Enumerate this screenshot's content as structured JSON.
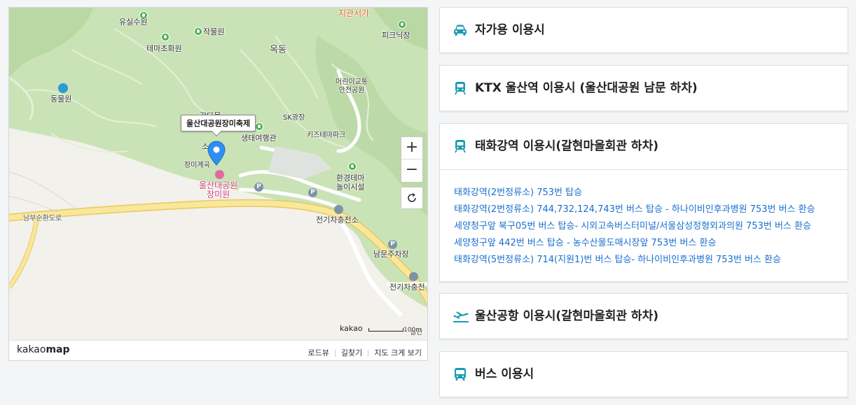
{
  "map": {
    "labels": {
      "yusil": "유실수원",
      "jakmul": "작물원",
      "tema": "테마초화원",
      "okdong": "옥동",
      "jigwan": "지관서가",
      "picnic": "피크닉장",
      "zoo": "동물원",
      "kids_safety": "어린이교통\n안전공원",
      "sk": "SK광장",
      "eco": "생태여행관",
      "kidspark": "키즈테마파크",
      "eco_play": "환경테마\n놀이시설",
      "rose_valley": "장미계곡",
      "rose_garden": "울산대공원\n장미원",
      "charge1": "전기차충전소",
      "charge2": "전기차충전",
      "south_parking": "남문주차장",
      "road": "남부순환도로",
      "partial1": "감다목",
      "partial2": "소",
      "partial3": "일반"
    },
    "callout": "울산대공원장미축제",
    "zoom_in": "+",
    "zoom_out": "−",
    "scale_brand": "kakao",
    "scale_text": "100m",
    "brand_light": "kakao",
    "brand_bold": "map",
    "footer_links": [
      "로드뷰",
      "길찾기",
      "지도 크게 보기"
    ]
  },
  "accordion": [
    {
      "icon": "car-icon",
      "title": "자가용 이용시"
    },
    {
      "icon": "train-icon",
      "title": "KTX 울산역 이용시 (울산대공원 남문 하차)"
    },
    {
      "icon": "train-icon",
      "title": "태화강역 이용시(갈현마을회관 하차)",
      "routes": [
        "태화강역(2번정류소) 753번 탑승",
        "태화강역(2번정류소) 744,732,124,743번 버스 탑승 - 하나이비인후과병원 753번 버스 환승",
        "세양청구앞 북구05번 버스 탑승- 시외고속버스터미널/서울삼성정형외과의원 753번 버스 환승",
        "세양청구앞 442번 버스 탑승 - 농수산물도매시장앞 753번 버스 환승",
        "태화강역(5번정류소) 714(지원1)번 버스 탑승- 하나이비인후과병원 753번 버스 환승"
      ]
    },
    {
      "icon": "plane-icon",
      "title": "울산공항 이용시(갈현마을회관 하차)"
    },
    {
      "icon": "bus-icon",
      "title": "버스 이용시"
    }
  ],
  "colors": {
    "accent": "#1a9bb5",
    "link": "#1a6fd0",
    "park_green": "#c9e3b6",
    "road_yellow": "#f5e08a",
    "marker_blue": "#2f8ff0"
  }
}
